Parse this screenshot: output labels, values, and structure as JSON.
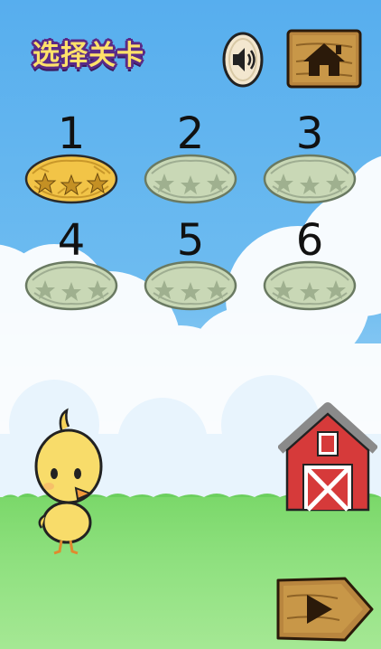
{
  "screen": {
    "title": "选择关卡",
    "sky_color": "#5fb3ee",
    "grass_color": "#8ee07e"
  },
  "controls": {
    "sound_icon": "speaker-icon",
    "home_icon": "home-icon",
    "next_icon": "play-arrow-icon"
  },
  "levels": [
    {
      "number": "1",
      "state": "unlocked",
      "nest_color": "#f2c447"
    },
    {
      "number": "2",
      "state": "locked",
      "nest_color": "#c9d8b6"
    },
    {
      "number": "3",
      "state": "locked",
      "nest_color": "#c9d8b6"
    },
    {
      "number": "4",
      "state": "locked",
      "nest_color": "#c9d8b6"
    },
    {
      "number": "5",
      "state": "locked",
      "nest_color": "#c9d8b6"
    },
    {
      "number": "6",
      "state": "locked",
      "nest_color": "#c9d8b6"
    }
  ]
}
